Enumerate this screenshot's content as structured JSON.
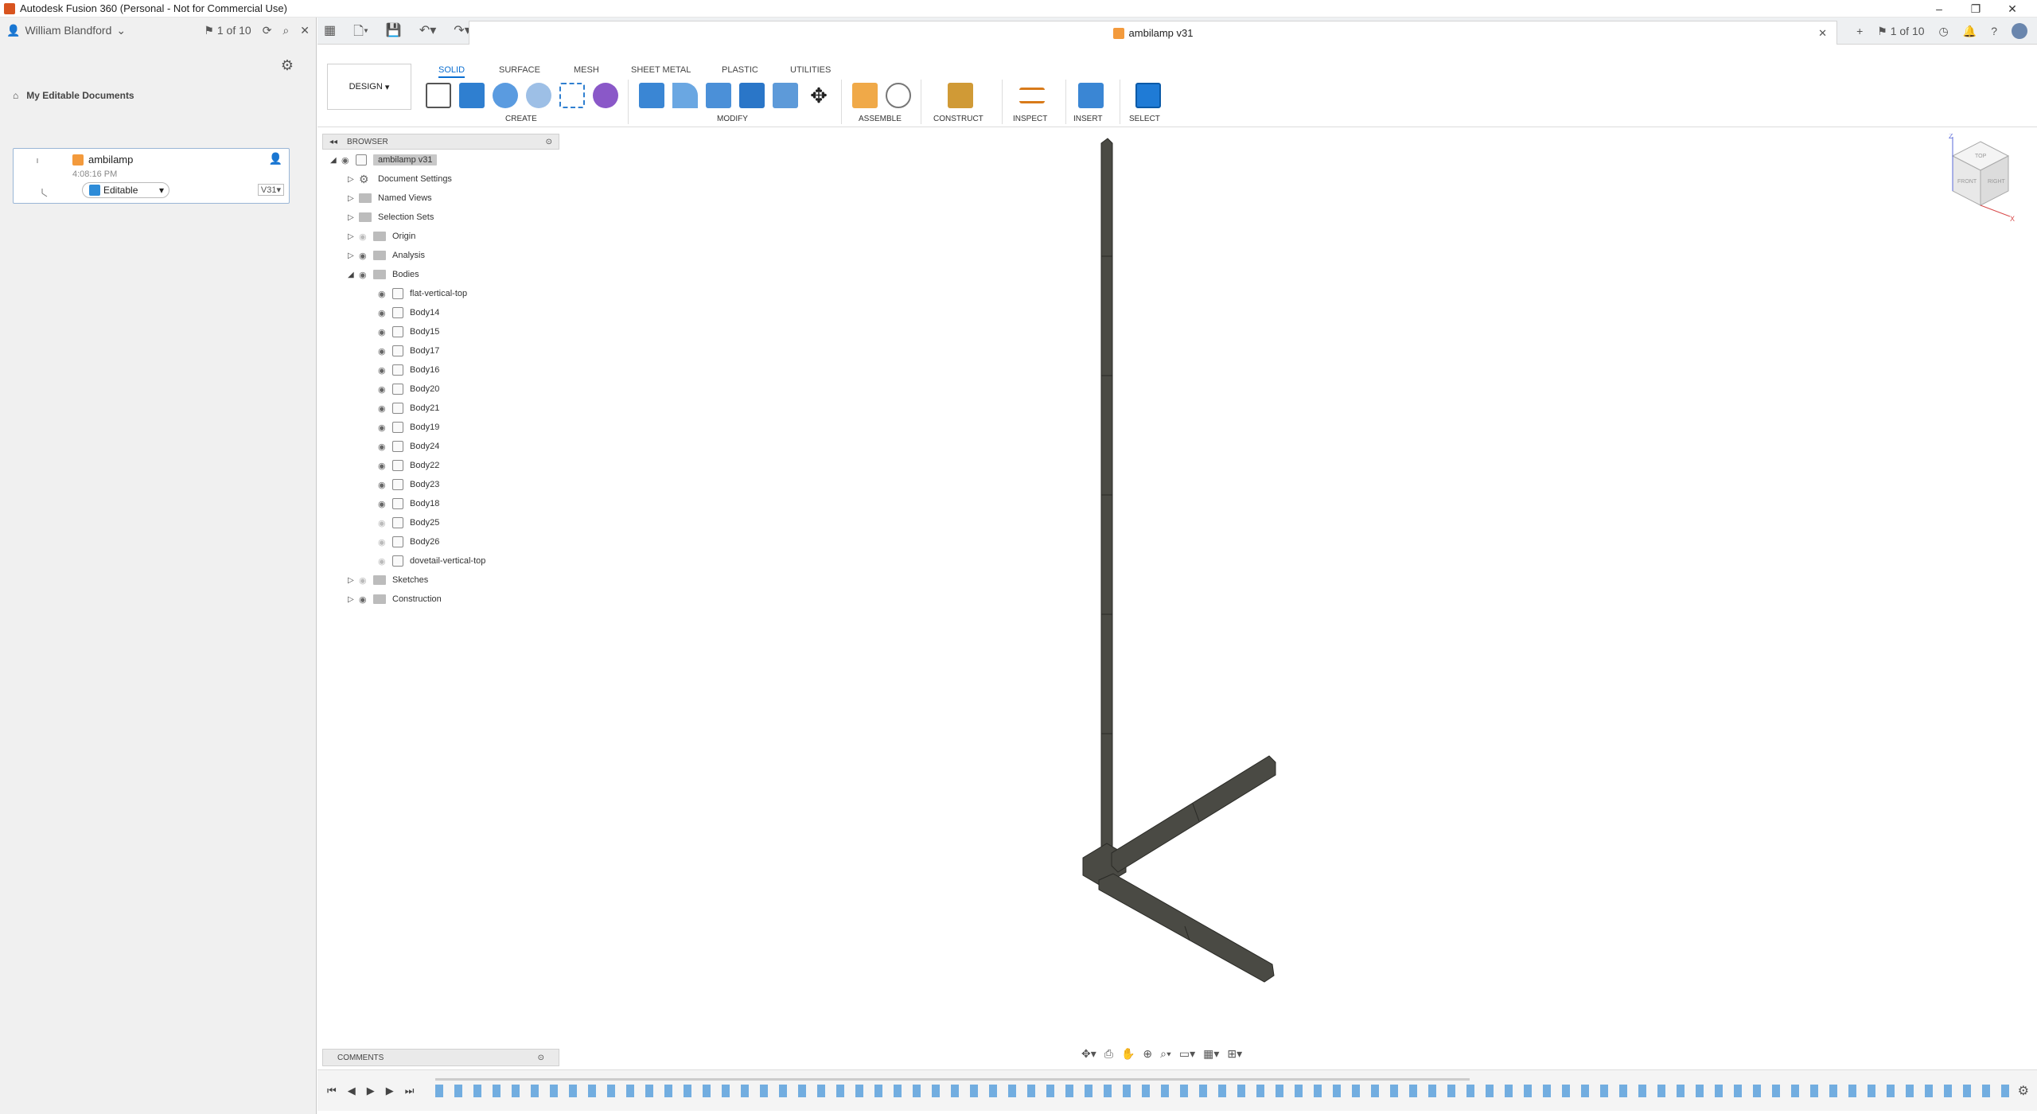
{
  "app": {
    "title": "Autodesk Fusion 360 (Personal - Not for Commercial Use)"
  },
  "left_panel": {
    "user": "William Blandford",
    "pager": "1 of 10",
    "breadcrumb": "My Editable Documents",
    "doc": {
      "name": "ambilamp",
      "time": "4:08:16 PM",
      "status": "Editable",
      "version": "V31"
    }
  },
  "tab": {
    "title": "ambilamp v31",
    "pager": "1 of 10"
  },
  "ribbon": {
    "workspace": "DESIGN",
    "tabs": [
      "SOLID",
      "SURFACE",
      "MESH",
      "SHEET METAL",
      "PLASTIC",
      "UTILITIES"
    ],
    "groups": [
      "CREATE",
      "MODIFY",
      "ASSEMBLE",
      "CONSTRUCT",
      "INSPECT",
      "INSERT",
      "SELECT"
    ]
  },
  "browser": {
    "header": "BROWSER",
    "root": "ambilamp v31",
    "folders_top": [
      "Document Settings",
      "Named Views",
      "Selection Sets",
      "Origin",
      "Analysis",
      "Bodies"
    ],
    "bodies": [
      "flat-vertical-top",
      "Body14",
      "Body15",
      "Body17",
      "Body16",
      "Body20",
      "Body21",
      "Body19",
      "Body24",
      "Body22",
      "Body23",
      "Body18",
      "Body25",
      "Body26",
      "dovetail-vertical-top"
    ],
    "folders_bottom": [
      "Sketches",
      "Construction"
    ]
  },
  "comments": {
    "label": "COMMENTS"
  },
  "viewcube": {
    "top": "TOP",
    "front": "FRONT",
    "right": "RIGHT",
    "x": "X",
    "z": "Z"
  },
  "colors": {
    "accent": "#0a6ed1",
    "body": "#4a4a44",
    "edge": "#2a2a26"
  }
}
